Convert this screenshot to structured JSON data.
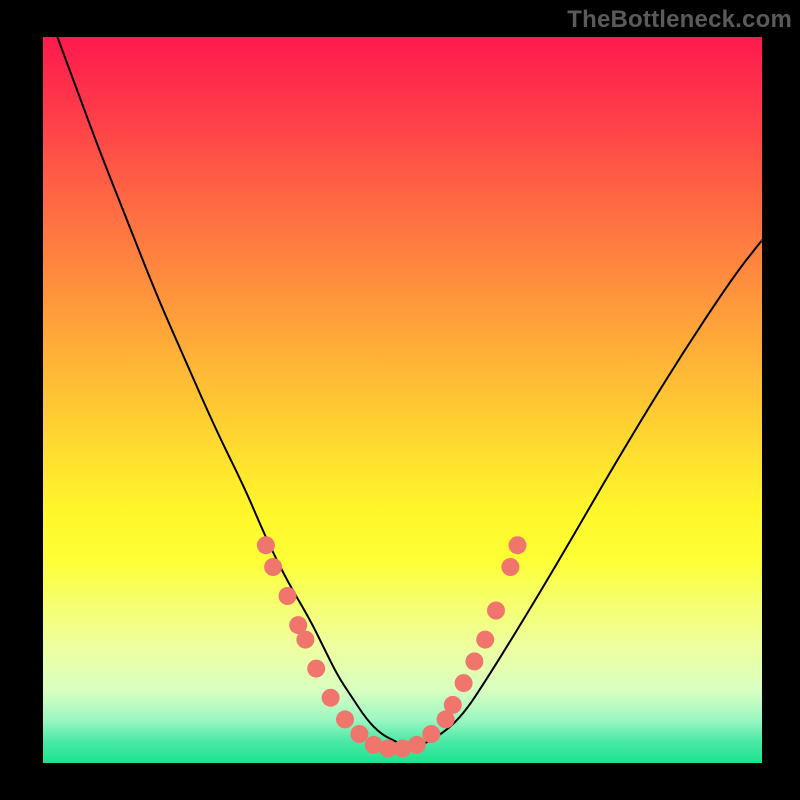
{
  "watermark": "TheBottleneck.com",
  "colors": {
    "background": "#000000",
    "curve": "#000000",
    "dots": "#f0766d"
  },
  "chart_data": {
    "type": "line",
    "title": "",
    "xlabel": "",
    "ylabel": "",
    "xlim": [
      0,
      100
    ],
    "ylim": [
      0,
      100
    ],
    "grid": false,
    "legend": false,
    "series": [
      {
        "name": "bottleneck-curve",
        "x": [
          2,
          5,
          8,
          12,
          16,
          20,
          24,
          28,
          31,
          34,
          37,
          39,
          41,
          43,
          45,
          47,
          49,
          51,
          54,
          58,
          62,
          67,
          73,
          80,
          88,
          96,
          100
        ],
        "y": [
          100,
          92,
          84,
          74,
          64,
          55,
          46,
          38,
          31,
          25,
          20,
          16,
          12,
          9,
          6,
          4,
          3,
          2,
          3,
          6,
          12,
          20,
          30,
          42,
          55,
          67,
          72
        ]
      }
    ],
    "dots": [
      {
        "x": 31,
        "y": 30
      },
      {
        "x": 32,
        "y": 27
      },
      {
        "x": 34,
        "y": 23
      },
      {
        "x": 35.5,
        "y": 19
      },
      {
        "x": 36.5,
        "y": 17
      },
      {
        "x": 38,
        "y": 13
      },
      {
        "x": 40,
        "y": 9
      },
      {
        "x": 42,
        "y": 6
      },
      {
        "x": 44,
        "y": 4
      },
      {
        "x": 46,
        "y": 2.5
      },
      {
        "x": 48,
        "y": 2
      },
      {
        "x": 50,
        "y": 2
      },
      {
        "x": 52,
        "y": 2.5
      },
      {
        "x": 54,
        "y": 4
      },
      {
        "x": 56,
        "y": 6
      },
      {
        "x": 57,
        "y": 8
      },
      {
        "x": 58.5,
        "y": 11
      },
      {
        "x": 60,
        "y": 14
      },
      {
        "x": 61.5,
        "y": 17
      },
      {
        "x": 63,
        "y": 21
      },
      {
        "x": 65,
        "y": 27
      },
      {
        "x": 66,
        "y": 30
      }
    ]
  }
}
